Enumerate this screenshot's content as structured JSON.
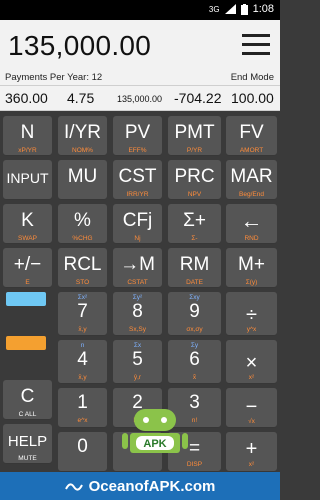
{
  "status_bar": {
    "network": "3G",
    "time": "1:08"
  },
  "display": {
    "value": "135,000.00",
    "payments_per_year_label": "Payments Per Year: 12",
    "end_mode_label": "End Mode"
  },
  "registers": [
    "360.00",
    "4.75",
    "135,000.00",
    "-704.22",
    "100.00"
  ],
  "keys": {
    "n": {
      "main": "N",
      "sub": "xP/YR"
    },
    "iyr": {
      "main": "I/YR",
      "sub": "NOM%"
    },
    "pv": {
      "main": "PV",
      "sub": "EFF%"
    },
    "pmt": {
      "main": "PMT",
      "sub": "P/YR"
    },
    "fv": {
      "main": "FV",
      "sub": "AMORT"
    },
    "input": {
      "main": "INPUT",
      "sub": ""
    },
    "mu": {
      "main": "MU",
      "sub": ""
    },
    "cst": {
      "main": "CST",
      "sub": "IRR/YR"
    },
    "prc": {
      "main": "PRC",
      "sub": "NPV"
    },
    "mar": {
      "main": "MAR",
      "sub": "Beg/End"
    },
    "k": {
      "main": "K",
      "sub": "SWAP"
    },
    "pct": {
      "main": "%",
      "sub": "%CHG"
    },
    "cfj": {
      "main": "CFj",
      "sub": "Nj"
    },
    "sigma_plus": {
      "main": "Σ+",
      "sub": "Σ-"
    },
    "backspace": {
      "main": "←",
      "sub": "RND"
    },
    "plusminus": {
      "main": "+/−",
      "sub": "E"
    },
    "rcl": {
      "main": "RCL",
      "sub": "STO"
    },
    "to_m": {
      "main": "→M",
      "sub": "CSTAT"
    },
    "rm": {
      "main": "RM",
      "sub": "DATE"
    },
    "m_plus": {
      "main": "M+",
      "sub": "Σ(y)"
    },
    "seven": {
      "main": "7",
      "top": "Σx²",
      "sub": "x̄,y"
    },
    "eight": {
      "main": "8",
      "top": "Σy²",
      "sub": "Sx,Sy"
    },
    "nine": {
      "main": "9",
      "top": "Σxy",
      "sub": "σx,σy"
    },
    "divide": {
      "main": "÷",
      "sub": "y^x"
    },
    "four": {
      "main": "4",
      "top": "n",
      "sub": "x̄,y"
    },
    "five": {
      "main": "5",
      "top": "Σx",
      "sub": "ŷ,r"
    },
    "six": {
      "main": "6",
      "top": "Σy",
      "sub": "x̂"
    },
    "multiply": {
      "main": "×",
      "sub": "x²"
    },
    "c": {
      "main": "C",
      "sub": "C ALL"
    },
    "one": {
      "main": "1",
      "sub": "e^x"
    },
    "two": {
      "main": "2",
      "sub": "LN"
    },
    "three": {
      "main": "3",
      "sub": "n!"
    },
    "minus": {
      "main": "−",
      "sub": "√x"
    },
    "help": {
      "main": "HELP",
      "sub": "MUTE"
    },
    "zero": {
      "main": "0",
      "sub": ""
    },
    "equals": {
      "main": "=",
      "sub": "DISP"
    },
    "plus": {
      "main": "+",
      "sub": "x²"
    }
  },
  "colors": {
    "accent_blue": "#6fc8f4",
    "accent_orange": "#f4a030",
    "key_bg": "#555555",
    "shift_orange": "#ff8c3a",
    "shift_blue": "#7fb2ff"
  },
  "watermark": {
    "site": "OceanofAPK.com",
    "badge": "APK"
  }
}
